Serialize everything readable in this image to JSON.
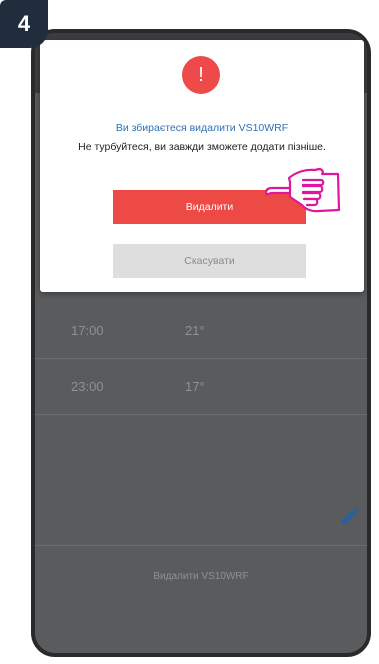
{
  "step": {
    "number": "4"
  },
  "dialog": {
    "title": "Ви збираєтеся видалити VS10WRF",
    "message": "Не турбуйтеся, ви завжди зможете додати пізніше.",
    "delete_label": "Видалити",
    "cancel_label": "Скасувати"
  },
  "schedule": {
    "rows": [
      {
        "time": "17:00",
        "temp": "21°"
      },
      {
        "time": "23:00",
        "temp": "17°"
      }
    ]
  },
  "footer": {
    "delete_device_label": "Видалити VS10WRF"
  },
  "colors": {
    "accent_red": "#ee4a45",
    "title_blue": "#2b72b8",
    "highlight_magenta": "#e0169b"
  },
  "icons": {
    "alert": "exclamation-icon",
    "edit": "pencil-icon",
    "pointer": "hand-pointer-icon"
  }
}
